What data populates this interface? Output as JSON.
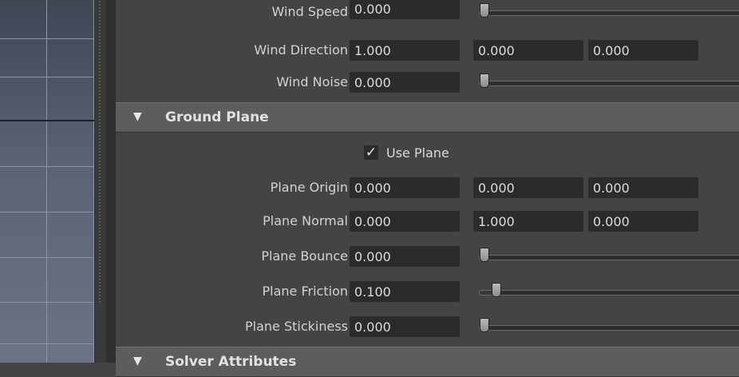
{
  "wind": {
    "speed": {
      "label": "Wind Speed",
      "value": "0.000",
      "slider_fraction": 0.0
    },
    "direction": {
      "label": "Wind Direction",
      "values": [
        "1.000",
        "0.000",
        "0.000"
      ]
    },
    "noise": {
      "label": "Wind Noise",
      "value": "0.000",
      "slider_fraction": 0.0
    }
  },
  "ground_plane": {
    "title": "Ground Plane",
    "use_plane": {
      "label": "Use Plane",
      "checked": true,
      "check_glyph": "✓"
    },
    "origin": {
      "label": "Plane Origin",
      "values": [
        "0.000",
        "0.000",
        "0.000"
      ]
    },
    "normal": {
      "label": "Plane Normal",
      "values": [
        "0.000",
        "1.000",
        "0.000"
      ]
    },
    "bounce": {
      "label": "Plane Bounce",
      "value": "0.000",
      "slider_fraction": 0.0
    },
    "friction": {
      "label": "Plane Friction",
      "value": "0.100",
      "slider_fraction": 0.1
    },
    "stickiness": {
      "label": "Plane Stickiness",
      "value": "0.000",
      "slider_fraction": 0.0
    }
  },
  "next_section": {
    "title": "Solver Attributes"
  },
  "icons": {
    "expand": "triangle-down-icon",
    "check": "checkmark-icon"
  }
}
